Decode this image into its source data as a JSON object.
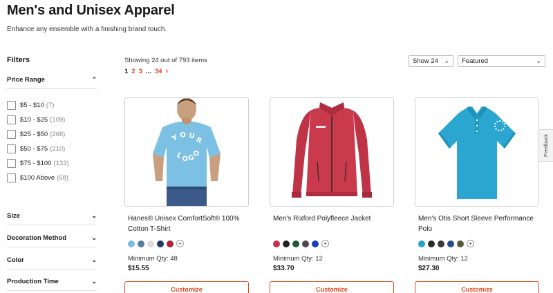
{
  "page": {
    "title": "Men's and Unisex Apparel",
    "subtitle": "Enhance any ensemble with a finishing brand touch."
  },
  "filters": {
    "heading": "Filters",
    "price_range": {
      "label": "Price Range",
      "expanded": true,
      "options": [
        {
          "label": "$5 - $10",
          "count": "(7)"
        },
        {
          "label": "$10 - $25",
          "count": "(109)"
        },
        {
          "label": "$25 - $50",
          "count": "(268)"
        },
        {
          "label": "$50 - $75",
          "count": "(210)"
        },
        {
          "label": "$75 - $100",
          "count": "(133)"
        },
        {
          "label": "$100 Above",
          "count": "(68)"
        }
      ]
    },
    "sections": [
      {
        "label": "Size"
      },
      {
        "label": "Decoration Method"
      },
      {
        "label": "Color"
      },
      {
        "label": "Production Time"
      }
    ]
  },
  "results": {
    "showing": "Showing 24 out of 793 items",
    "pagination": {
      "current": "1",
      "pages": [
        "2",
        "3"
      ],
      "ellipsis": "...",
      "last": "34",
      "next_icon": "chevron-right-icon"
    },
    "show_select": "Show 24",
    "sort_select": "Featured"
  },
  "products": [
    {
      "title": "Hanes® Unisex ComfortSoft® 100% Cotton T-Shirt",
      "swatches": [
        "#7bbde0",
        "#5a7a99",
        "#dddddd",
        "#1f3a6b",
        "#b0243a"
      ],
      "min_qty": "Minimum Qty: 48",
      "price": "$15.55",
      "cta": "Customize",
      "product_color": "#7cc1e4"
    },
    {
      "title": "Men's Rixford Polyfleece Jacket",
      "swatches": [
        "#c43048",
        "#222222",
        "#1f5a3a",
        "#4a4a4a",
        "#1a3fb0"
      ],
      "min_qty": "Minimum Qty: 12",
      "price": "$33.70",
      "cta": "Customize",
      "product_color": "#c93a4c"
    },
    {
      "title": "Men's Otis Short Sleeve Performance Polo",
      "swatches": [
        "#2aa3cc",
        "#2a2a2a",
        "#3a3a3a",
        "#1f4f8a",
        "#555a3a"
      ],
      "min_qty": "Minimum Qty: 12",
      "price": "$27.30",
      "cta": "Customize",
      "product_color": "#2aa6d0"
    }
  ],
  "swatch_more": "+",
  "feedback": "Feedback",
  "icons": {
    "expand": "chevron-down-icon",
    "collapse": "chevron-up-icon"
  },
  "colors": {
    "accent": "#e0461f"
  }
}
